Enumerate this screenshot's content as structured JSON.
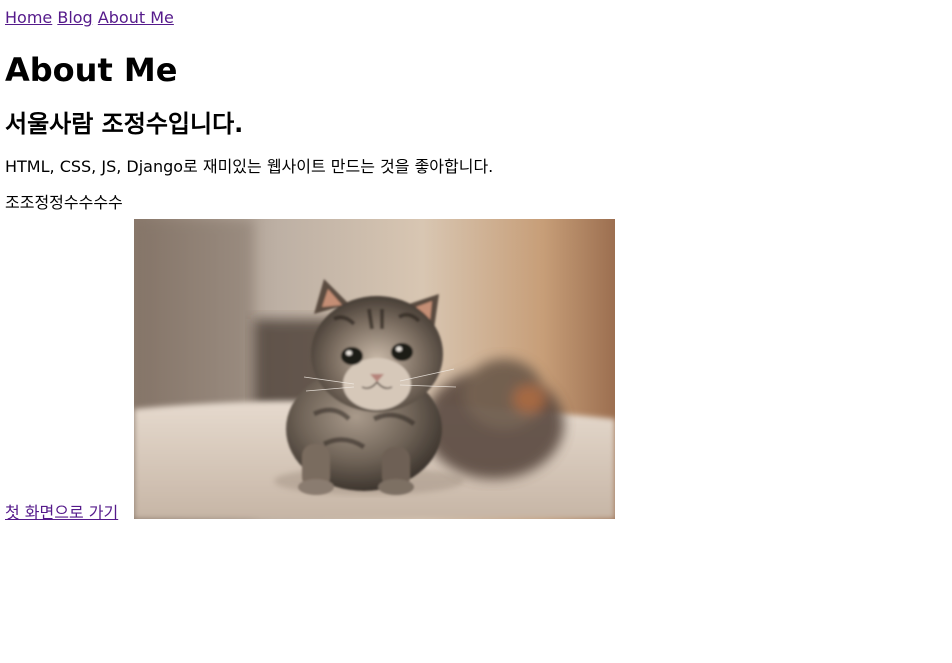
{
  "nav": {
    "home": "Home",
    "blog": "Blog",
    "about": "About Me"
  },
  "page_title": "About Me",
  "subtitle": "서울사람 조정수입니다.",
  "intro": "HTML, CSS, JS, Django로 재미있는 웹사이트 만드는 것을 좋아합니다.",
  "nickname": "조조정정수수수수",
  "home_link": "첫 화면으로 가기",
  "image": {
    "subject": "kitten-photo",
    "colors": {
      "wall": "#c8a07c",
      "floor": "#efe6dc",
      "fur_light": "#b7a899",
      "fur_dark": "#3b342e"
    }
  }
}
